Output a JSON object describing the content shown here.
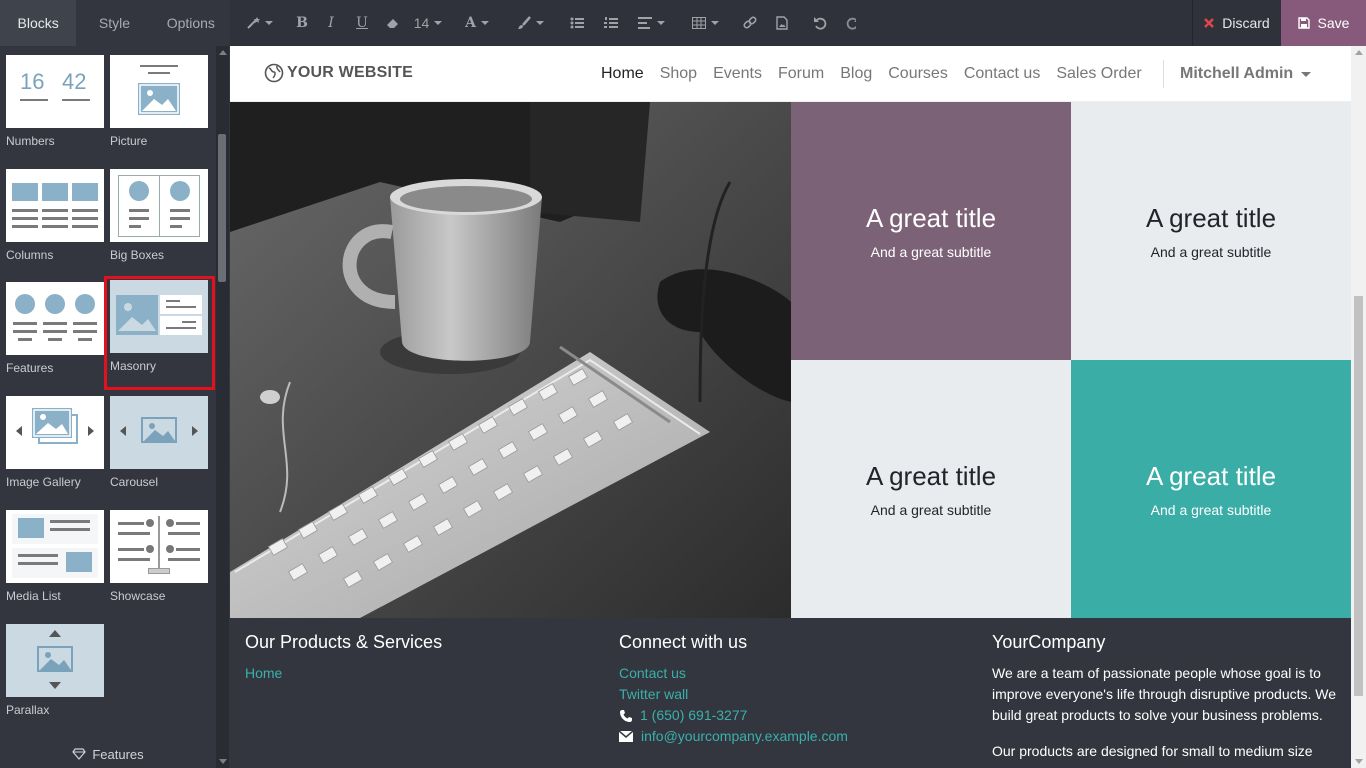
{
  "panel": {
    "tabs": [
      {
        "label": "Blocks"
      },
      {
        "label": "Style"
      },
      {
        "label": "Options"
      }
    ],
    "thumb_labels": {
      "numbers": [
        "16",
        "42"
      ]
    },
    "snippets": [
      {
        "label": "Numbers"
      },
      {
        "label": "Picture"
      },
      {
        "label": "Columns"
      },
      {
        "label": "Big Boxes"
      },
      {
        "label": "Features"
      },
      {
        "label": "Masonry"
      },
      {
        "label": "Image Gallery"
      },
      {
        "label": "Carousel"
      },
      {
        "label": "Media List"
      },
      {
        "label": "Showcase"
      },
      {
        "label": "Parallax"
      }
    ],
    "selected_snippet": "Masonry",
    "footer_category": "Features"
  },
  "toolbar": {
    "font_size": "14",
    "discard_label": "Discard",
    "save_label": "Save"
  },
  "site": {
    "logo_text": "YOUR WEBSITE",
    "nav": [
      {
        "label": "Home",
        "active": true
      },
      {
        "label": "Shop"
      },
      {
        "label": "Events"
      },
      {
        "label": "Forum"
      },
      {
        "label": "Blog"
      },
      {
        "label": "Courses"
      },
      {
        "label": "Contact us"
      },
      {
        "label": "Sales Order"
      }
    ],
    "user_name": "Mitchell Admin",
    "tiles": [
      {
        "title": "A great title",
        "subtitle": "And a great subtitle",
        "bg": "#7c6276",
        "fg": "#ffffff"
      },
      {
        "title": "A great title",
        "subtitle": "And a great subtitle",
        "bg": "#e9ecef",
        "fg": "#212529"
      },
      {
        "title": "A great title",
        "subtitle": "And a great subtitle",
        "bg": "#e9ecef",
        "fg": "#212529"
      },
      {
        "title": "A great title",
        "subtitle": "And a great subtitle",
        "bg": "#3aada7",
        "fg": "#ffffff"
      }
    ],
    "footer": {
      "products": {
        "heading": "Our Products & Services",
        "links": [
          "Home"
        ]
      },
      "connect": {
        "heading": "Connect with us",
        "links": [
          "Contact us",
          "Twitter wall"
        ],
        "phone": "1 (650) 691-3277",
        "email": "info@yourcompany.example.com"
      },
      "company": {
        "heading": "YourCompany",
        "para1": "We are a team of passionate people whose goal is to improve everyone's life through disruptive products. We build great products to solve your business problems.",
        "para2": "Our products are designed for small to medium size"
      }
    }
  },
  "colors": {
    "accent": "#875a7b",
    "link": "#3ab0ab",
    "selection": "#e3111d"
  }
}
